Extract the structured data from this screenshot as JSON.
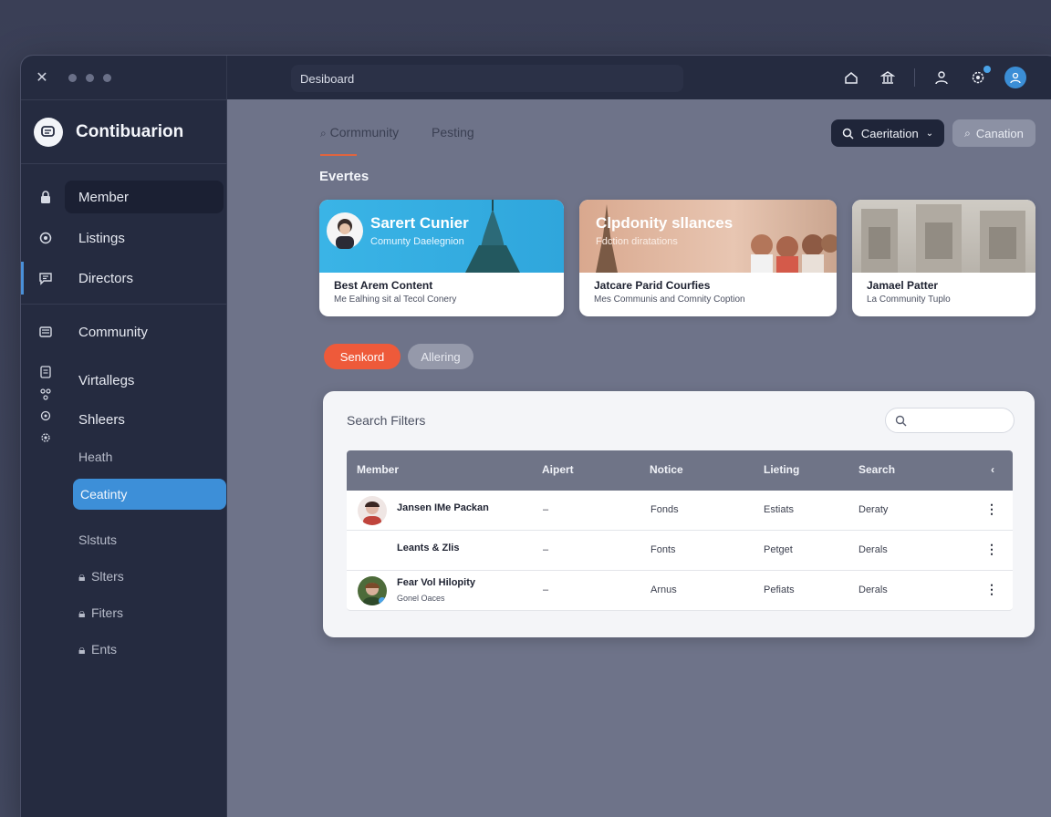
{
  "window": {
    "close_glyph": "✕"
  },
  "sidebar": {
    "brand": "Contibuarion",
    "items": [
      {
        "label": "Member",
        "icon": "lock-icon"
      },
      {
        "label": "Listings",
        "icon": "settings-icon"
      },
      {
        "label": "Directors",
        "icon": "chat-icon"
      },
      {
        "label": "Community",
        "icon": "list-icon"
      },
      {
        "label": "Virtallegs",
        "icon": "doc-icon"
      },
      {
        "label": "Shleers",
        "icon": "nodes-icon"
      },
      {
        "label": "Heath",
        "icon": ""
      },
      {
        "label": "Ceatinty",
        "icon": ""
      },
      {
        "label": "Slstuts",
        "icon": ""
      },
      {
        "label": "Slters",
        "icon": "lock-small-icon"
      },
      {
        "label": "Fiters",
        "icon": "lock-small-icon"
      },
      {
        "label": "Ents",
        "icon": "lock-small-icon"
      }
    ]
  },
  "header": {
    "breadcrumb": "Desiboard"
  },
  "main": {
    "tabs": [
      {
        "label": "Cormmunity"
      },
      {
        "label": "Pesting"
      }
    ],
    "buttons": {
      "primary": "Caeritation",
      "secondary": "Canation"
    },
    "section_title": "Evertes",
    "cards": [
      {
        "headline": "Sarert Cunier",
        "subline": "Comunty Daelegnion",
        "title": "Best Arem Content",
        "subtitle": "Me Ealhing sit al Tecol Conery"
      },
      {
        "headline": "Clpdonity sllances",
        "subline": "Fdction diratations",
        "title": "Jatcare Parid Courfies",
        "subtitle": "Mes Communis and Comnity Coption"
      },
      {
        "headline": "",
        "subline": "",
        "title": "Jamael Patter",
        "subtitle": "La Community Tuplo"
      }
    ],
    "chips": {
      "active": "Senkord",
      "inactive": "Allering"
    },
    "panel": {
      "title": "Search Filters",
      "search_placeholder": "",
      "columns": [
        "Member",
        "Aipert",
        "Notice",
        "Lieting",
        "Search"
      ],
      "rows": [
        {
          "name": "Jansen IMe Packan",
          "sub": "",
          "aipert": "–",
          "notice": "Fonds",
          "listing": "Estiats",
          "search": "Deraty"
        },
        {
          "name": "Leants & Zlis",
          "sub": "",
          "aipert": "–",
          "notice": "Fonts",
          "listing": "Petget",
          "search": "Derals"
        },
        {
          "name": "Fear Vol Hilopity",
          "sub": "Gonel Oaces",
          "aipert": "–",
          "notice": "Arnus",
          "listing": "Pefiats",
          "search": "Derals"
        }
      ]
    }
  },
  "colors": {
    "accent": "#3d8fd8",
    "orange": "#ee5a3a",
    "sidebar": "#252b40"
  }
}
